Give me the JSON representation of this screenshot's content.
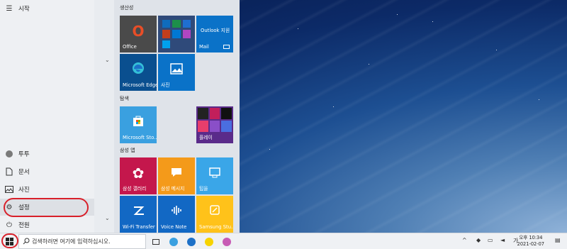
{
  "start_menu": {
    "title": "시작",
    "user": "투투",
    "items": [
      {
        "label": "문서",
        "icon": "document-icon"
      },
      {
        "label": "사진",
        "icon": "picture-icon"
      },
      {
        "label": "설정",
        "icon": "gear-icon"
      },
      {
        "label": "전원",
        "icon": "power-icon"
      }
    ]
  },
  "groups": {
    "productivity": "생산성",
    "explore": "탐색",
    "samsung": "삼성 앱"
  },
  "tiles": {
    "office": "Office",
    "outlook": "Outlook 지원",
    "mail": "Mail",
    "edge": "Microsoft Edge",
    "photos": "사진",
    "store": "Microsoft Sto...",
    "play": "플레이",
    "gallery": "삼성 갤러리",
    "messages": "삼성 메시지",
    "notes": "팁을",
    "wifi": "Wi-Fi Transfer",
    "voicenote": "Voice Note",
    "samsung_st": "Samsung Stu..."
  },
  "taskbar": {
    "search_placeholder": "검색하려면 여기에 입력하십시오.",
    "ime": "가",
    "clock_time": "오후 10:34",
    "clock_date": "2021-02-07"
  },
  "colors": {
    "highlight_circle": "#d8202a",
    "office_tile": "#4a4a4a",
    "tile_blue": "#0a72c8",
    "tile_lightblue": "#3aa0e0",
    "gallery_tile": "#c4174c",
    "message_tile": "#f49a1a",
    "notes_tile": "#3aa6e8",
    "samsung_st_tile": "#ffc21a"
  }
}
